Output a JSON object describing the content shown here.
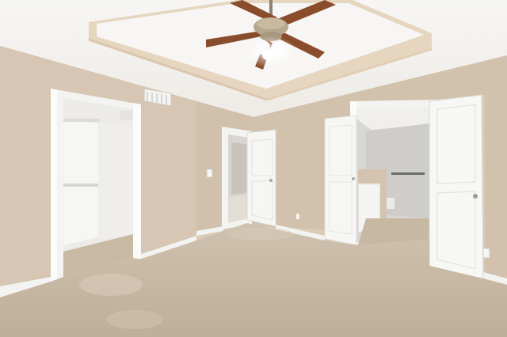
{
  "scene": {
    "kind": "photo",
    "subject": "empty bedroom"
  },
  "colors": {
    "ceiling": "#f4f3f1",
    "tray_trim": "#e6d6bf",
    "wall_left": "#d6c6b3",
    "wall_back": "#d3c2ae",
    "wall_right": "#cdbba6",
    "carpet": "#c9baa6",
    "trim_white": "#f3f3f1",
    "door_white": "#f6f6f5",
    "fan_blade": "#8a4d2c",
    "fan_body": "#b7a78f"
  },
  "icons": {
    "ceiling_fan": "ceiling-fan",
    "vent": "air-vent",
    "outlet": "wall-outlet",
    "switch": "light-switch"
  }
}
